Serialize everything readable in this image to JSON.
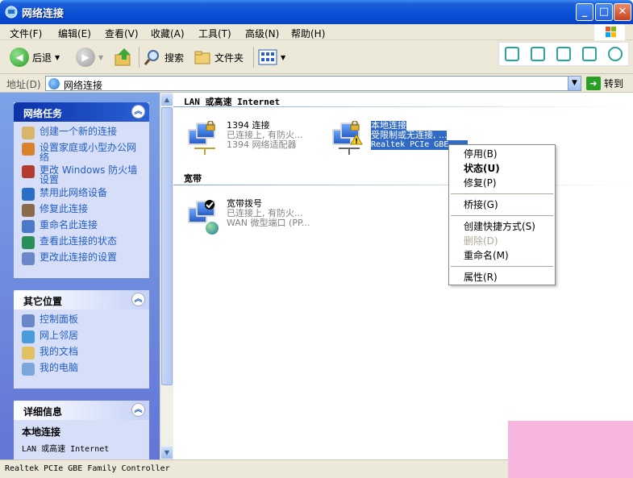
{
  "window": {
    "title": "网络连接",
    "min": "_",
    "max": "□",
    "close": "✕"
  },
  "menu": [
    "文件(F)",
    "编辑(E)",
    "查看(V)",
    "收藏(A)",
    "工具(T)",
    "高级(N)",
    "帮助(H)"
  ],
  "toolbar": {
    "back": "后退",
    "search": "搜索",
    "folders": "文件夹"
  },
  "address": {
    "label": "地址(D)",
    "value": "网络连接",
    "go": "转到"
  },
  "network_tasks": {
    "title": "网络任务",
    "items": [
      {
        "label": "创建一个新的连接",
        "icon": "new-connection-icon",
        "color": "#d9b56a"
      },
      {
        "label": "设置家庭或小型办公网络",
        "icon": "home-network-icon",
        "color": "#d9822b"
      },
      {
        "label": "更改 Windows 防火墙设置",
        "icon": "firewall-icon",
        "color": "#b33c2f"
      },
      {
        "label": "禁用此网络设备",
        "icon": "disable-device-icon",
        "color": "#2a6fc7"
      },
      {
        "label": "修复此连接",
        "icon": "repair-icon",
        "color": "#8a6a4a"
      },
      {
        "label": "重命名此连接",
        "icon": "rename-icon",
        "color": "#4a7ac7"
      },
      {
        "label": "查看此连接的状态",
        "icon": "status-icon",
        "color": "#2a8f5a"
      },
      {
        "label": "更改此连接的设置",
        "icon": "settings-icon",
        "color": "#6a88c9"
      }
    ]
  },
  "other_places": {
    "title": "其它位置",
    "items": [
      {
        "label": "控制面板",
        "icon": "control-panel-icon",
        "color": "#6a88c9"
      },
      {
        "label": "网上邻居",
        "icon": "network-places-icon",
        "color": "#4a9bd9"
      },
      {
        "label": "我的文档",
        "icon": "my-documents-icon",
        "color": "#e0c060"
      },
      {
        "label": "我的电脑",
        "icon": "my-computer-icon",
        "color": "#7aa6d9"
      }
    ]
  },
  "details": {
    "title": "详细信息",
    "name": "本地连接",
    "sub": "LAN 或高速 Internet"
  },
  "groups": {
    "lan": "LAN 或高速 Internet",
    "broadband": "宽带"
  },
  "connections": [
    {
      "name": "1394 连接",
      "status": "已连接上, 有防火...",
      "device": "1394 网络适配器"
    },
    {
      "name": "本地连接",
      "status": "受限制或无连接, ...",
      "device": "Realtek PCIe GBE ..."
    },
    {
      "name": "宽带拨号",
      "status": "已连接上, 有防火...",
      "device": "WAN 微型端口 (PP..."
    }
  ],
  "context_menu": {
    "disable": "停用(B)",
    "status": "状态(U)",
    "repair": "修复(P)",
    "bridge": "桥接(G)",
    "shortcut": "创建快捷方式(S)",
    "delete": "删除(D)",
    "rename": "重命名(M)",
    "properties": "属性(R)"
  },
  "statusbar": "Realtek PCIe GBE Family Controller"
}
